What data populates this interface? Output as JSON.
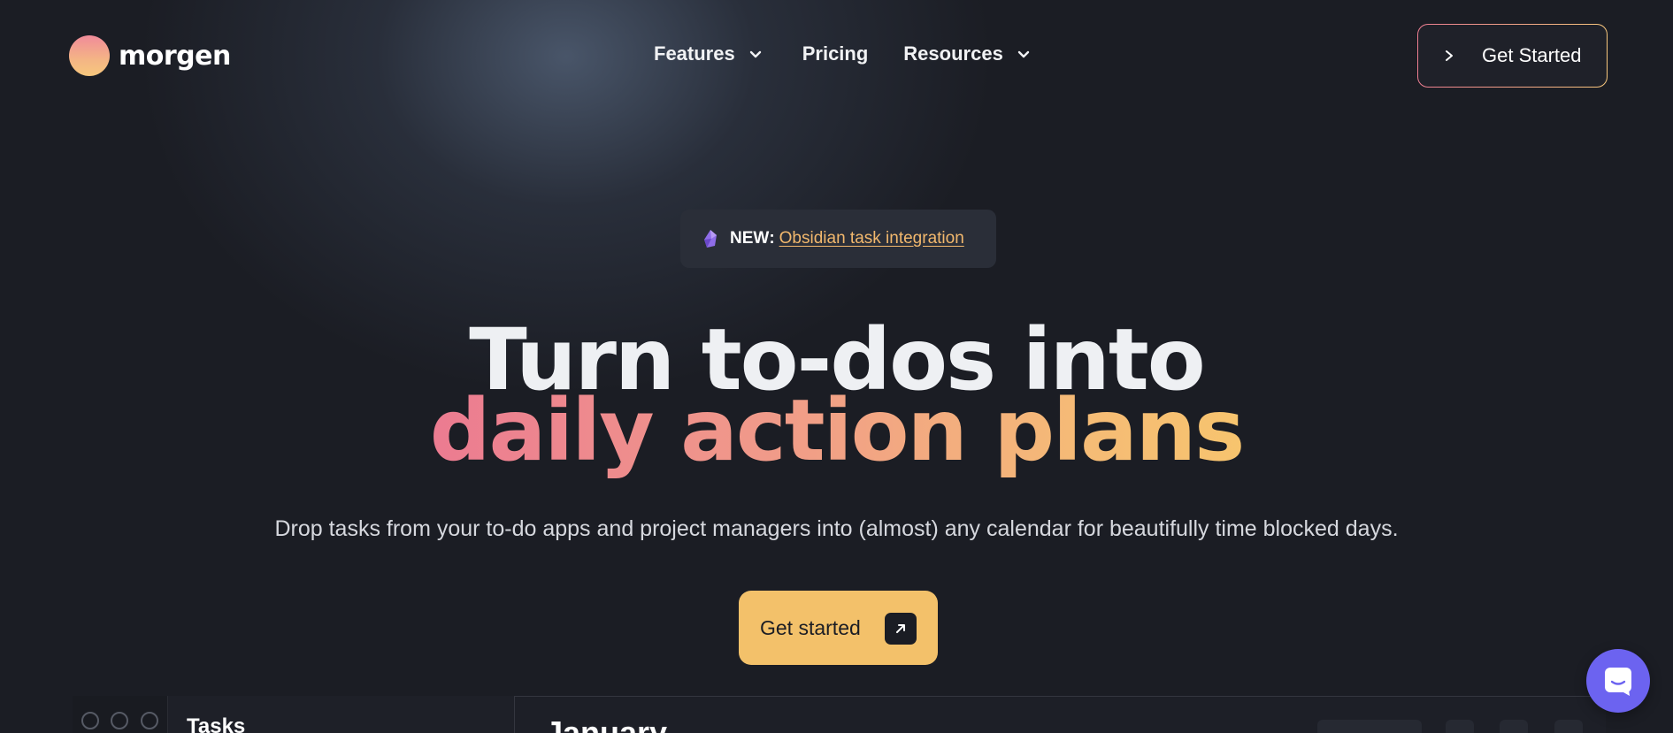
{
  "brand": {
    "name": "morgen"
  },
  "nav": {
    "items": [
      {
        "label": "Features",
        "has_dropdown": true
      },
      {
        "label": "Pricing",
        "has_dropdown": false
      },
      {
        "label": "Resources",
        "has_dropdown": true
      }
    ],
    "cta_label": "Get Started"
  },
  "announcement": {
    "tag": "NEW",
    "colon": ":",
    "link_text": "Obsidian task integration",
    "icon": "obsidian-gem-icon"
  },
  "hero": {
    "headline_line1": "Turn to-dos into",
    "headline_line2": "daily action plans",
    "subtitle": "Drop tasks from your to-do apps and project managers into (almost) any calendar for beautifully time blocked days.",
    "cta_label": "Get started"
  },
  "preview": {
    "tasks_title": "Tasks",
    "month_title": "January"
  },
  "colors": {
    "background": "#1b1d24",
    "accent_yellow": "#f3c16a",
    "gradient_pink": "#ec7b91",
    "gradient_orange": "#f7c46e",
    "chat_purple": "#6c63f0"
  },
  "icons": [
    "chevron-down-icon",
    "chevron-right-icon",
    "arrow-up-right-icon",
    "chat-icon"
  ]
}
